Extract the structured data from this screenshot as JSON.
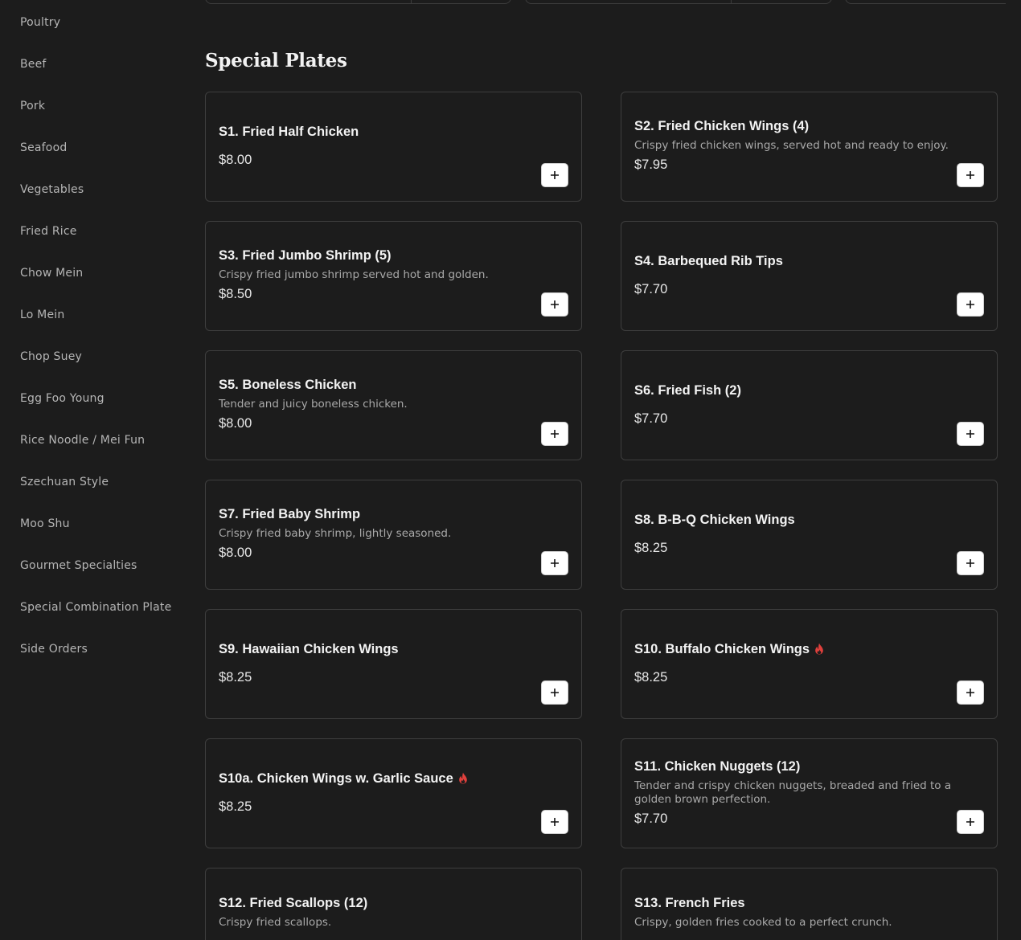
{
  "sidebar": {
    "items": [
      {
        "label": "Poultry"
      },
      {
        "label": "Beef"
      },
      {
        "label": "Pork"
      },
      {
        "label": "Seafood"
      },
      {
        "label": "Vegetables"
      },
      {
        "label": "Fried Rice"
      },
      {
        "label": "Chow Mein"
      },
      {
        "label": "Lo Mein"
      },
      {
        "label": "Chop Suey"
      },
      {
        "label": "Egg Foo Young"
      },
      {
        "label": "Rice Noodle / Mei Fun"
      },
      {
        "label": "Szechuan Style"
      },
      {
        "label": "Moo Shu"
      },
      {
        "label": "Gourmet Specialties"
      },
      {
        "label": "Special Combination Plate"
      },
      {
        "label": "Side Orders"
      }
    ]
  },
  "section": {
    "title": "Special Plates"
  },
  "items": [
    {
      "name": "S1. Fried Half Chicken",
      "desc": "",
      "price": "$8.00",
      "spicy": false
    },
    {
      "name": "S2. Fried Chicken Wings (4)",
      "desc": "Crispy fried chicken wings, served hot and ready to enjoy.",
      "price": "$7.95",
      "spicy": false
    },
    {
      "name": "S3. Fried Jumbo Shrimp (5)",
      "desc": "Crispy fried jumbo shrimp served hot and golden.",
      "price": "$8.50",
      "spicy": false
    },
    {
      "name": "S4. Barbequed Rib Tips",
      "desc": "",
      "price": "$7.70",
      "spicy": false
    },
    {
      "name": "S5. Boneless Chicken",
      "desc": "Tender and juicy boneless chicken.",
      "price": "$8.00",
      "spicy": false
    },
    {
      "name": "S6. Fried Fish (2)",
      "desc": "",
      "price": "$7.70",
      "spicy": false
    },
    {
      "name": "S7. Fried Baby Shrimp",
      "desc": "Crispy fried baby shrimp, lightly seasoned.",
      "price": "$8.00",
      "spicy": false
    },
    {
      "name": "S8. B-B-Q Chicken Wings",
      "desc": "",
      "price": "$8.25",
      "spicy": false
    },
    {
      "name": "S9. Hawaiian Chicken Wings",
      "desc": "",
      "price": "$8.25",
      "spicy": false
    },
    {
      "name": "S10. Buffalo Chicken Wings",
      "desc": "",
      "price": "$8.25",
      "spicy": true
    },
    {
      "name": "S10a. Chicken Wings w. Garlic Sauce",
      "desc": "",
      "price": "$8.25",
      "spicy": true
    },
    {
      "name": "S11. Chicken Nuggets (12)",
      "desc": "Tender and crispy chicken nuggets, breaded and fried to a golden brown perfection.",
      "price": "$7.70",
      "spicy": false
    },
    {
      "name": "S12. Fried Scallops (12)",
      "desc": "Crispy fried scallops.",
      "price": "",
      "spicy": false
    },
    {
      "name": "S13. French Fries",
      "desc": "Crispy, golden fries cooked to a perfect crunch.",
      "price": "",
      "spicy": false
    }
  ],
  "icons": {
    "add": "plus-icon",
    "spicy": "flame-icon"
  },
  "colors": {
    "background": "#1c1c1c",
    "card_border": "#3e3e3e",
    "spicy": "#e0403c",
    "text": "#f3f3f3",
    "muted": "#a9a9a9"
  }
}
